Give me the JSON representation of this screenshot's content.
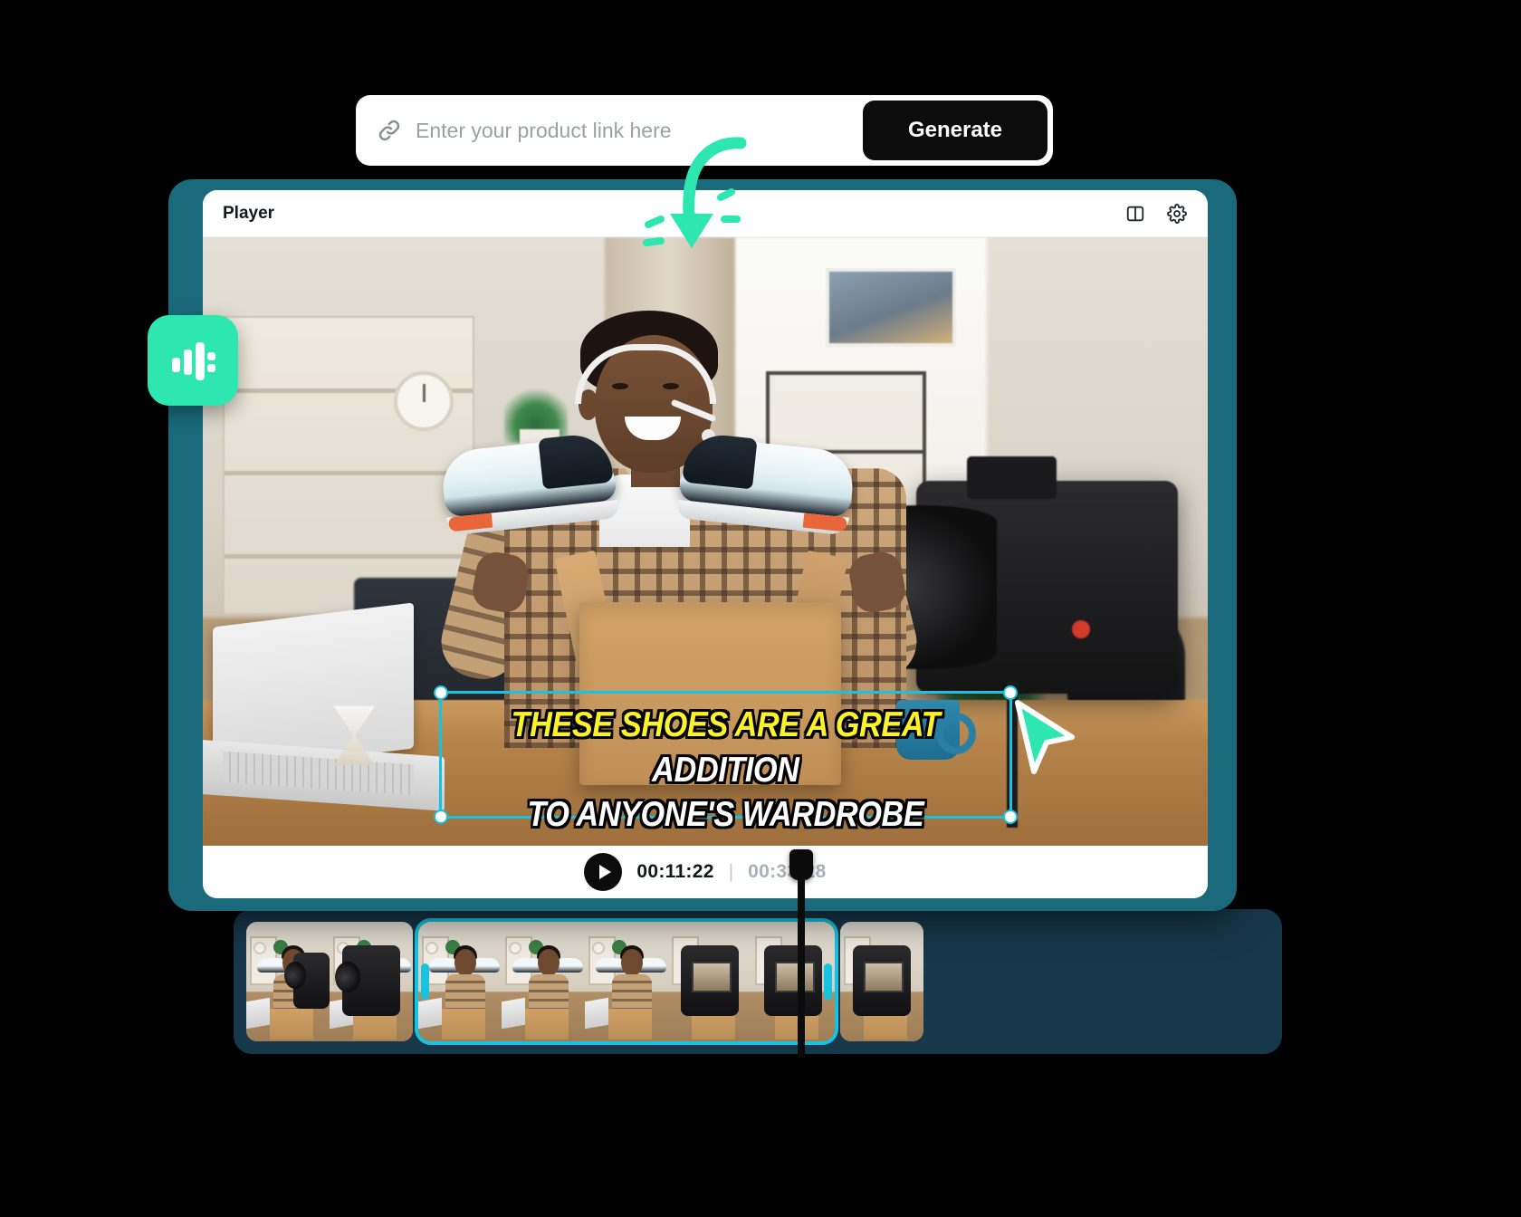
{
  "top_bar": {
    "link_icon": "link-icon",
    "input_placeholder": "Enter your product link here",
    "input_value": "",
    "generate_label": "Generate"
  },
  "annotations": {
    "arrow_icon": "curved-down-arrow-annotation",
    "cursor_icon": "mouse-pointer-cursor",
    "audio_badge_icon": "audio-waveform-icon",
    "accent_teal": "#2ee6b0",
    "accent_cyan": "#17c3e0"
  },
  "player": {
    "title": "Player",
    "tools": [
      {
        "name": "split-view-icon",
        "label": "Split view"
      },
      {
        "name": "gear-icon",
        "label": "Settings"
      }
    ]
  },
  "caption": {
    "line1_highlight": "THESE SHOES ARE A GREAT",
    "line1_rest": "ADDITION",
    "line2": "TO ANYONE'S WARDROBE",
    "highlight_color": "#fbf22c",
    "text_color": "#ffffff",
    "selection_color": "#17c3e0"
  },
  "transport": {
    "play_icon": "play-icon",
    "current_time": "00:11:22",
    "separator": "|",
    "total_time": "00:33:28"
  },
  "timeline": {
    "frame_color": "#17374a",
    "selected_clip_index": 1,
    "clips": [
      {
        "name": "clip-1",
        "selected": false,
        "thumbs": [
          "wide",
          "wide"
        ]
      },
      {
        "name": "clip-2",
        "selected": true,
        "thumbs": [
          "wide",
          "wide",
          "wide",
          "camera",
          "camera"
        ]
      },
      {
        "name": "clip-3",
        "selected": false,
        "thumbs": [
          "camera"
        ]
      }
    ]
  }
}
